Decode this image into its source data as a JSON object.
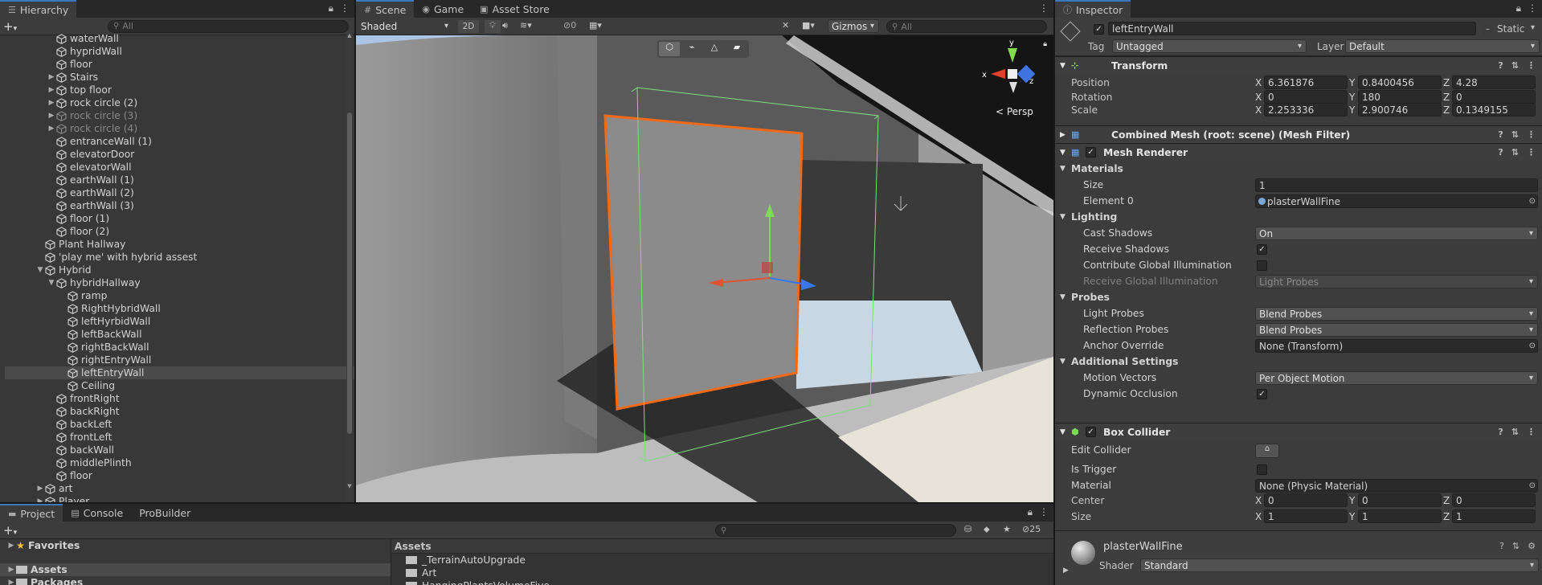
{
  "hierarchy": {
    "tab_label": "Hierarchy",
    "search_placeholder": "All",
    "rows": [
      {
        "label": "waterWall",
        "depth": 2,
        "arrow": "",
        "dim": false
      },
      {
        "label": "hypridWall",
        "depth": 2,
        "arrow": "",
        "dim": false
      },
      {
        "label": "floor",
        "depth": 2,
        "arrow": "",
        "dim": false
      },
      {
        "label": "Stairs",
        "depth": 2,
        "arrow": "▶",
        "dim": false
      },
      {
        "label": "top floor",
        "depth": 2,
        "arrow": "▶",
        "dim": false
      },
      {
        "label": "rock circle (2)",
        "depth": 2,
        "arrow": "▶",
        "dim": false
      },
      {
        "label": "rock circle (3)",
        "depth": 2,
        "arrow": "▶",
        "dim": true
      },
      {
        "label": "rock circle (4)",
        "depth": 2,
        "arrow": "▶",
        "dim": true
      },
      {
        "label": "entranceWall (1)",
        "depth": 2,
        "arrow": "",
        "dim": false
      },
      {
        "label": "elevatorDoor",
        "depth": 2,
        "arrow": "",
        "dim": false
      },
      {
        "label": "elevatorWall",
        "depth": 2,
        "arrow": "",
        "dim": false
      },
      {
        "label": "earthWall (1)",
        "depth": 2,
        "arrow": "",
        "dim": false
      },
      {
        "label": "earthWall (2)",
        "depth": 2,
        "arrow": "",
        "dim": false
      },
      {
        "label": "earthWall (3)",
        "depth": 2,
        "arrow": "",
        "dim": false
      },
      {
        "label": "floor (1)",
        "depth": 2,
        "arrow": "",
        "dim": false
      },
      {
        "label": "floor (2)",
        "depth": 2,
        "arrow": "",
        "dim": false
      },
      {
        "label": "Plant Hallway",
        "depth": 1,
        "arrow": "",
        "dim": false
      },
      {
        "label": "'play me' with hybrid assest",
        "depth": 1,
        "arrow": "",
        "dim": false
      },
      {
        "label": "Hybrid",
        "depth": 1,
        "arrow": "▼",
        "dim": false
      },
      {
        "label": "hybridHallway",
        "depth": 2,
        "arrow": "▼",
        "dim": false
      },
      {
        "label": "ramp",
        "depth": 3,
        "arrow": "",
        "dim": false
      },
      {
        "label": "RightHybridWall",
        "depth": 3,
        "arrow": "",
        "dim": false
      },
      {
        "label": "leftHyrbidWall",
        "depth": 3,
        "arrow": "",
        "dim": false
      },
      {
        "label": "leftBackWall",
        "depth": 3,
        "arrow": "",
        "dim": false
      },
      {
        "label": "rightBackWall",
        "depth": 3,
        "arrow": "",
        "dim": false
      },
      {
        "label": "rightEntryWall",
        "depth": 3,
        "arrow": "",
        "dim": false
      },
      {
        "label": "leftEntryWall",
        "depth": 3,
        "arrow": "",
        "dim": false,
        "selected": true
      },
      {
        "label": "Ceiling",
        "depth": 3,
        "arrow": "",
        "dim": false
      },
      {
        "label": "frontRight",
        "depth": 2,
        "arrow": "",
        "dim": false
      },
      {
        "label": "backRight",
        "depth": 2,
        "arrow": "",
        "dim": false
      },
      {
        "label": "backLeft",
        "depth": 2,
        "arrow": "",
        "dim": false
      },
      {
        "label": "frontLeft",
        "depth": 2,
        "arrow": "",
        "dim": false
      },
      {
        "label": "backWall",
        "depth": 2,
        "arrow": "",
        "dim": false
      },
      {
        "label": "middlePlinth",
        "depth": 2,
        "arrow": "",
        "dim": false
      },
      {
        "label": "floor",
        "depth": 2,
        "arrow": "",
        "dim": false
      },
      {
        "label": "art",
        "depth": 1,
        "arrow": "▶",
        "dim": false
      },
      {
        "label": "Player",
        "depth": 1,
        "arrow": "▶",
        "dim": false
      }
    ]
  },
  "scene": {
    "tabs": [
      "Scene",
      "Game",
      "Asset Store"
    ],
    "shading_mode": "Shaded",
    "mode_2d": "2D",
    "hidden_count": "0",
    "gizmos_label": "Gizmos",
    "search_placeholder": "All",
    "persp_label": "< Persp",
    "axis_x": "x",
    "axis_y": "y",
    "axis_z": "z"
  },
  "inspector": {
    "tab_label": "Inspector",
    "object_name": "leftEntryWall",
    "static_label": "Static",
    "tag_label": "Tag",
    "tag_value": "Untagged",
    "layer_label": "Layer",
    "layer_value": "Default",
    "transform": {
      "title": "Transform",
      "position_label": "Position",
      "rotation_label": "Rotation",
      "scale_label": "Scale",
      "position": {
        "x": "6.361876",
        "y": "0.8400456",
        "z": "4.28"
      },
      "rotation": {
        "x": "0",
        "y": "180",
        "z": "0"
      },
      "scale": {
        "x": "2.253336",
        "y": "2.900746",
        "z": "0.1349155"
      }
    },
    "mesh_filter_title": "Combined Mesh (root: scene) (Mesh Filter)",
    "mesh_renderer": {
      "title": "Mesh Renderer",
      "materials_label": "Materials",
      "size_label": "Size",
      "size_value": "1",
      "element0_label": "Element 0",
      "element0_value": "plasterWallFine",
      "lighting_label": "Lighting",
      "cast_shadows_label": "Cast Shadows",
      "cast_shadows_value": "On",
      "receive_shadows_label": "Receive Shadows",
      "contribute_gi_label": "Contribute Global Illumination",
      "receive_gi_label": "Receive Global Illumination",
      "receive_gi_value": "Light Probes",
      "probes_label": "Probes",
      "light_probes_label": "Light Probes",
      "light_probes_value": "Blend Probes",
      "reflection_probes_label": "Reflection Probes",
      "reflection_probes_value": "Blend Probes",
      "anchor_override_label": "Anchor Override",
      "anchor_override_value": "None (Transform)",
      "additional_label": "Additional Settings",
      "motion_vectors_label": "Motion Vectors",
      "motion_vectors_value": "Per Object Motion",
      "dynamic_occlusion_label": "Dynamic Occlusion"
    },
    "box_collider": {
      "title": "Box Collider",
      "edit_collider_label": "Edit Collider",
      "is_trigger_label": "Is Trigger",
      "material_label": "Material",
      "material_value": "None (Physic Material)",
      "center_label": "Center",
      "size_label": "Size",
      "center": {
        "x": "0",
        "y": "0",
        "z": "0"
      },
      "size": {
        "x": "1",
        "y": "1",
        "z": "1"
      }
    },
    "material": {
      "name": "plasterWallFine",
      "shader_label": "Shader",
      "shader_value": "Standard"
    }
  },
  "project": {
    "tabs": [
      "Project",
      "Console",
      "ProBuilder"
    ],
    "badge_count": "25",
    "favorites_label": "Favorites",
    "assets_label": "Assets",
    "packages_label": "Packages",
    "assets_header": "Assets",
    "asset_folders": [
      "_TerrainAutoUpgrade",
      "Art",
      "HangingPlantsVolumeFive"
    ]
  },
  "colors": {
    "accent_blue": "#3a79bb",
    "selection_orange": "#f06a1a",
    "collider_green": "#7be07b"
  }
}
